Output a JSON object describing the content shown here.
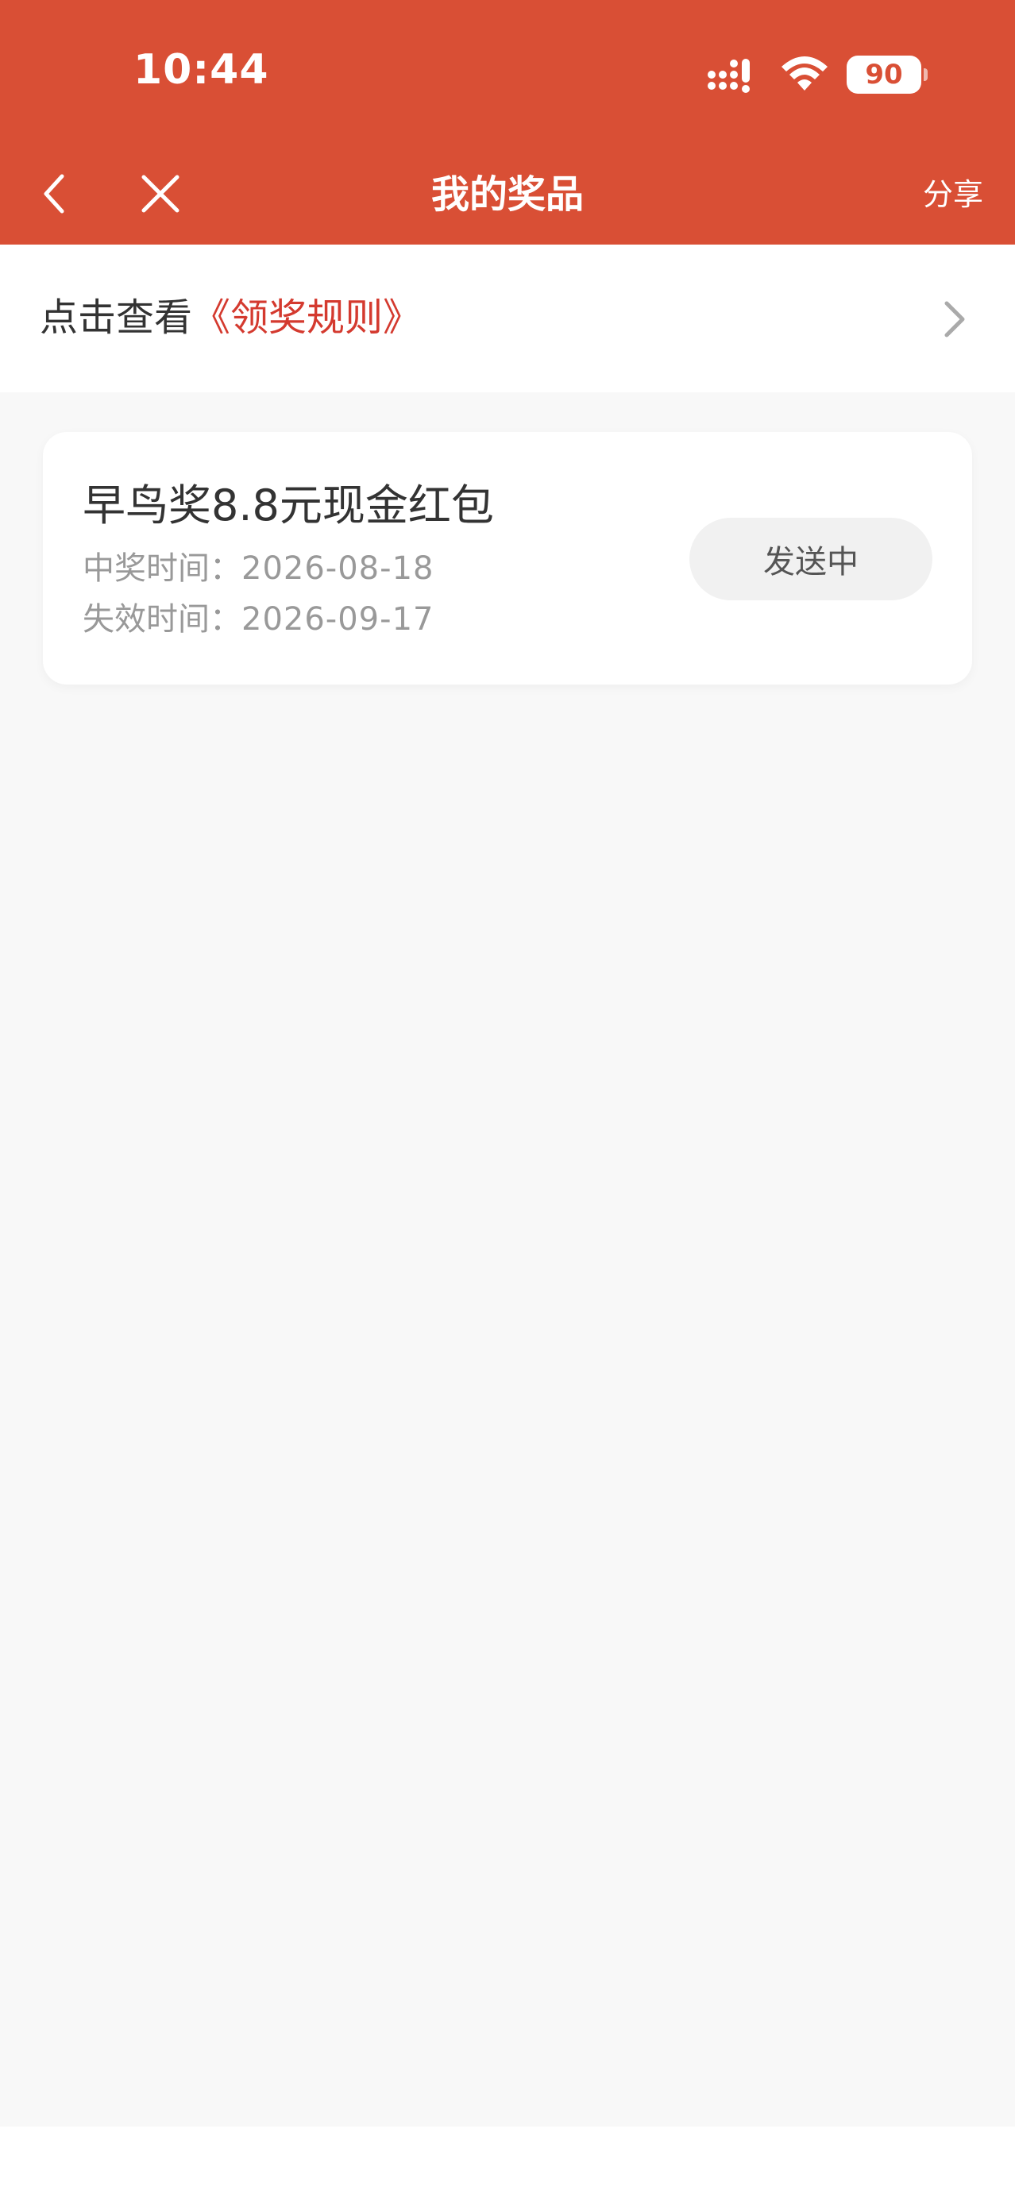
{
  "status_bar": {
    "time": "10:44",
    "battery": "90",
    "signal_icon": "cellular-signal-icon",
    "wifi_icon": "wifi-icon"
  },
  "nav": {
    "title": "我的奖品",
    "share_label": "分享",
    "back_icon": "chevron-left-icon",
    "close_icon": "close-icon"
  },
  "rules": {
    "prefix": "点击查看",
    "link_text": "《领奖规则》",
    "chevron_icon": "chevron-right-icon"
  },
  "prizes": [
    {
      "name": "早鸟奖8.8元现金红包",
      "win_label": "中奖时间：",
      "win_date": "2026-08-18",
      "expire_label": "失效时间：",
      "expire_date": "2026-09-17",
      "status": "发送中"
    }
  ],
  "colors": {
    "header_background": "#d94f35",
    "link": "#d43a2f",
    "page_background": "#f8f8f8"
  }
}
